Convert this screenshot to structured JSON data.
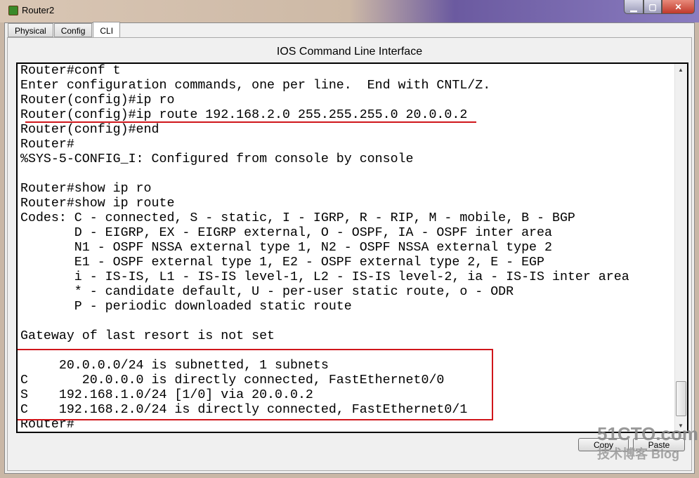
{
  "window": {
    "title": "Router2"
  },
  "tabs": [
    {
      "label": "Physical"
    },
    {
      "label": "Config"
    },
    {
      "label": "CLI",
      "active": true
    }
  ],
  "cli": {
    "heading": "IOS Command Line Interface",
    "lines": [
      "Router#conf t",
      "Enter configuration commands, one per line.  End with CNTL/Z.",
      "Router(config)#ip ro",
      "Router(config)#ip route 192.168.2.0 255.255.255.0 20.0.0.2",
      "Router(config)#end",
      "Router#",
      "%SYS-5-CONFIG_I: Configured from console by console",
      "",
      "Router#show ip ro",
      "Router#show ip route",
      "Codes: C - connected, S - static, I - IGRP, R - RIP, M - mobile, B - BGP",
      "       D - EIGRP, EX - EIGRP external, O - OSPF, IA - OSPF inter area",
      "       N1 - OSPF NSSA external type 1, N2 - OSPF NSSA external type 2",
      "       E1 - OSPF external type 1, E2 - OSPF external type 2, E - EGP",
      "       i - IS-IS, L1 - IS-IS level-1, L2 - IS-IS level-2, ia - IS-IS inter area",
      "       * - candidate default, U - per-user static route, o - ODR",
      "       P - periodic downloaded static route",
      "",
      "Gateway of last resort is not set",
      "",
      "     20.0.0.0/24 is subnetted, 1 subnets",
      "C       20.0.0.0 is directly connected, FastEthernet0/0",
      "S    192.168.1.0/24 [1/0] via 20.0.0.2",
      "C    192.168.2.0/24 is directly connected, FastEthernet0/1",
      "Router#"
    ]
  },
  "buttons": {
    "copy": "Copy",
    "paste": "Paste"
  },
  "annotation_color": "#d0161b",
  "watermark": {
    "main": "51CTO.com",
    "sub": "技术博客 Blog"
  }
}
